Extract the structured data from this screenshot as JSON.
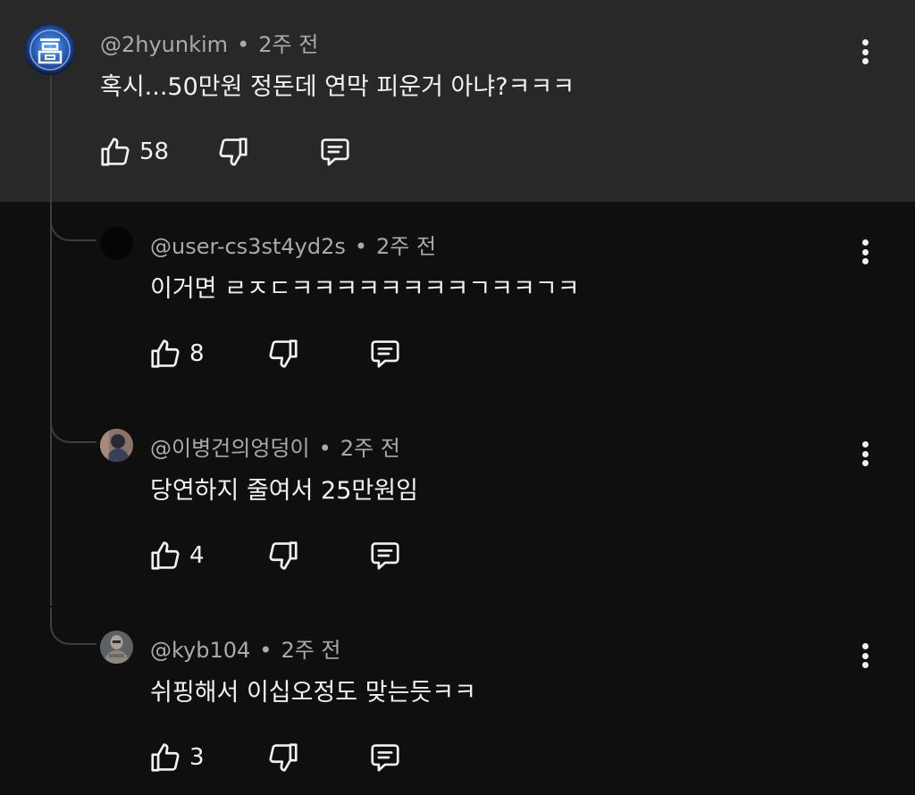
{
  "comments": [
    {
      "handle": "@2hyunkim",
      "time": "2주 전",
      "text": "혹시...50만원 정돈데 연막 피운거 아냐?ㅋㅋㅋ",
      "likes": "58",
      "avatar_icon": "blue-emblem-avatar"
    },
    {
      "handle": "@user-cs3st4yd2s",
      "time": "2주 전",
      "text": "이거면 ㄹㅈㄷㅋㅋㅋㅋㅋㅋㅋㅋㄱㅋㅋㄱㅋ",
      "likes": "8",
      "avatar_icon": "black-avatar"
    },
    {
      "handle": "@이병건의엉덩이",
      "time": "2주 전",
      "text": "당연하지 줄여서 25만원임",
      "likes": "4",
      "avatar_icon": "photo-avatar"
    },
    {
      "handle": "@kyb104",
      "time": "2주 전",
      "text": "쉬핑해서 이십오정도 맞는듯ㅋㅋ",
      "likes": "3",
      "avatar_icon": "knight-avatar"
    }
  ],
  "icons": {
    "like": "thumbs-up-icon",
    "dislike": "thumbs-down-icon",
    "reply": "reply-icon",
    "more": "more-vert-icon"
  },
  "colors": {
    "top_background": "#282828",
    "background": "#0f0f0f",
    "text": "#f1f1f1",
    "meta": "#aaaaaa"
  }
}
